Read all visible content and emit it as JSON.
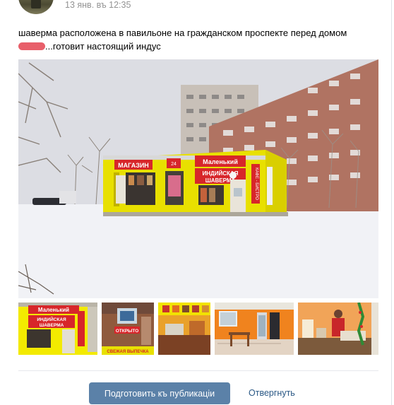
{
  "post": {
    "date": "13 янв. въ 12:35",
    "text_line1": "шаверма расположена в павильоне на гражданском проспекте перед домом",
    "text_line2": "...готовит настоящий индус"
  },
  "photo_signs": {
    "magazin": "МАГАЗИН",
    "malenkiy": "Маленький",
    "indian": "ИНДИЙСКАЯ",
    "shawarma": "ШАВЕРМА",
    "cafe": "КАФЕ - БИСТРО",
    "open": "ОТКРЫТО",
    "pastry": "СВЕЖАЯ ВЫПЕЧКА"
  },
  "actions": {
    "prepare_label": "Подготовить къ публикаціи",
    "reject_label": "Отвергнуть"
  },
  "colors": {
    "primary_button": "#5b81a8",
    "link": "#2a5885",
    "redaction": "#e85f6a",
    "pavilion_yellow": "#f2e200"
  }
}
